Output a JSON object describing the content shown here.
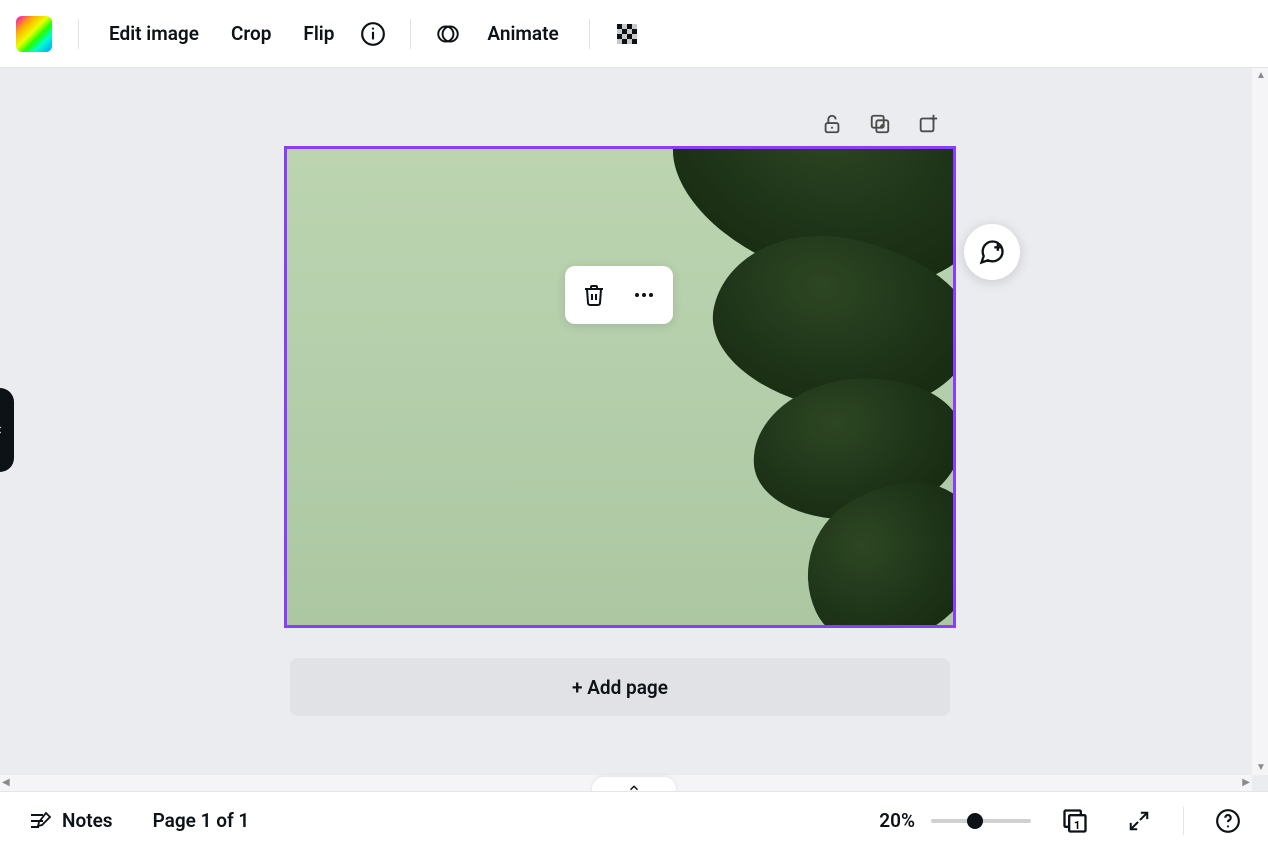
{
  "toolbar": {
    "edit_image_label": "Edit image",
    "crop_label": "Crop",
    "flip_label": "Flip",
    "animate_label": "Animate"
  },
  "canvas": {
    "add_page_label": "+ Add page"
  },
  "bottombar": {
    "notes_label": "Notes",
    "page_indicator": "Page 1 of 1",
    "zoom_value": "20%",
    "page_badge": "1"
  }
}
